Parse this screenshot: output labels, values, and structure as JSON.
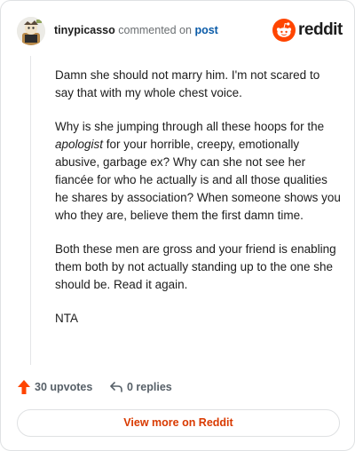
{
  "header": {
    "username": "tinypicasso",
    "action_text": "commented on",
    "post_link": "post",
    "brand": "reddit"
  },
  "comment": {
    "paragraphs": [
      "Damn she should not marry him. I'm not scared to say that with my whole chest voice.",
      {
        "before": "Why is she jumping through all these hoops for the ",
        "emphasis": "apologist",
        "after": " for your horrible, creepy, emotionally abusive, garbage ex? Why can she not see her fiancée for who he actually is and all those qualities he shares by association? When someone shows you who they are, believe them the first damn time."
      },
      "Both these men are gross and your friend is enabling them both by not actually standing up to the one she should be. Read it again.",
      "NTA"
    ]
  },
  "stats": {
    "upvotes": "30 upvotes",
    "replies": "0 replies"
  },
  "cta": {
    "label": "View more on Reddit"
  },
  "colors": {
    "brand_orange": "#ff4500",
    "link_blue": "#0a5ba8",
    "cta_text": "#d93a00",
    "meta_gray": "#576068"
  },
  "icons": {
    "avatar": "user-avatar",
    "brand": "reddit-snoo-icon",
    "upvote": "upvote-arrow-icon",
    "reply": "reply-arrow-icon"
  }
}
